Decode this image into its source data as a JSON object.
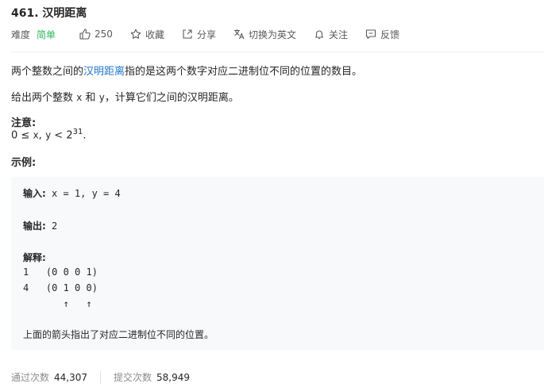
{
  "problem": {
    "title": "461. 汉明距离",
    "difficulty_label": "难度",
    "difficulty": "简单",
    "likes": "250",
    "collect": "收藏",
    "share": "分享",
    "switch_lang": "切换为英文",
    "follow": "关注",
    "feedback": "反馈"
  },
  "description": {
    "p1_a": "两个整数之间的",
    "p1_link": "汉明距离",
    "p1_b": "指的是这两个数字对应二进制位不同的位置的数目。",
    "p2_a": "给出两个整数 ",
    "p2_x": "x",
    "p2_and": " 和 ",
    "p2_y": "y",
    "p2_b": "，计算它们之间的汉明距离。",
    "note_title": "注意:",
    "note_a": "0 ≤ ",
    "note_x": "x",
    "note_comma": ", ",
    "note_y": "y",
    "note_b": " < 2",
    "note_sup": "31",
    "note_end": ".",
    "example_title": "示例:"
  },
  "example": {
    "input_label": "输入:",
    "input_value": " x = 1, y = 4",
    "output_label": "输出:",
    "output_value": " 2",
    "explain_label": "解释:",
    "line1": "1   (0 0 0 1)",
    "line2": "4   (0 1 0 0)",
    "arrows": "       ↑   ↑",
    "conclusion": "上面的箭头指出了对应二进制位不同的位置。"
  },
  "stats": {
    "accepted_label": "通过次数",
    "accepted": "44,307",
    "submitted_label": "提交次数",
    "submitted": "58,949"
  }
}
